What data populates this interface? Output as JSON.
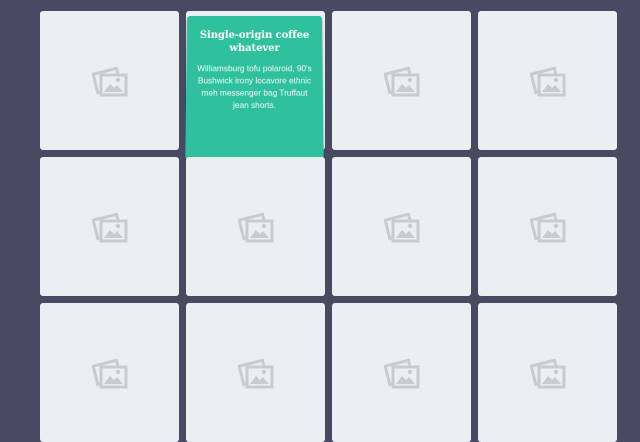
{
  "gallery": {
    "tiles": [
      {
        "icon": "image-placeholder-icon"
      },
      {
        "icon": "image-placeholder-icon",
        "hover": {
          "title": "Single-origin coffee whatever",
          "description": "Williamsburg tofu polaroid, 90's Bushwick irony locavore ethnic meh messenger bag Truffaut jean shorts."
        }
      },
      {
        "icon": "image-placeholder-icon"
      },
      {
        "icon": "image-placeholder-icon"
      },
      {
        "icon": "image-placeholder-icon"
      },
      {
        "icon": "image-placeholder-icon"
      },
      {
        "icon": "image-placeholder-icon"
      },
      {
        "icon": "image-placeholder-icon"
      },
      {
        "icon": "image-placeholder-icon"
      },
      {
        "icon": "image-placeholder-icon"
      },
      {
        "icon": "image-placeholder-icon"
      },
      {
        "icon": "image-placeholder-icon"
      }
    ]
  },
  "colors": {
    "page_background": "#474a61",
    "tile_background": "#ebeff1",
    "overlay_accent": "#2fc19d",
    "icon_color": "#c7ccd2"
  }
}
